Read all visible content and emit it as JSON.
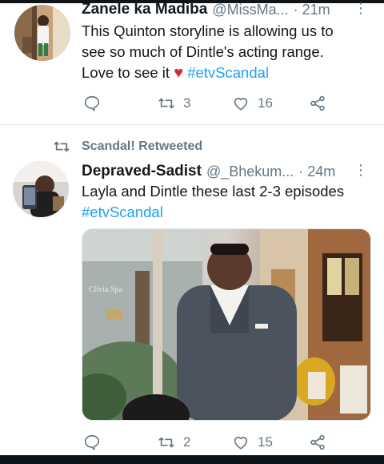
{
  "tweets": [
    {
      "display_name": "Zanele ka Madiba",
      "handle": "@MissMa...",
      "time": "· 21m",
      "text_line1": "This Quinton storyline is allowing us to",
      "text_line2": "see so much of Dintle's acting range.",
      "text_line3_pre": "Love to see it",
      "text_line3_hashtag": "#etvScandal",
      "replies": "",
      "retweets": "3",
      "likes": "16"
    },
    {
      "retweeted_by": "Scandal! Retweeted",
      "display_name": "Depraved-Sadist",
      "handle": "@_Bhekum...",
      "time": "· 24m",
      "text_line1": "Layla and Dintle these last 2-3 episodes",
      "text_line2_hashtag": "#etvScandal",
      "media_sign_text": "Clivia Spa",
      "replies": "",
      "retweets": "2",
      "likes": "15"
    }
  ],
  "colors": {
    "accent": "#1da1f2",
    "muted": "#657786",
    "text": "#14171a",
    "heart": "#d7263d"
  },
  "icons": {
    "reply": "reply-icon",
    "retweet": "retweet-icon",
    "like": "like-icon",
    "share": "share-icon",
    "more": "more-icon"
  }
}
